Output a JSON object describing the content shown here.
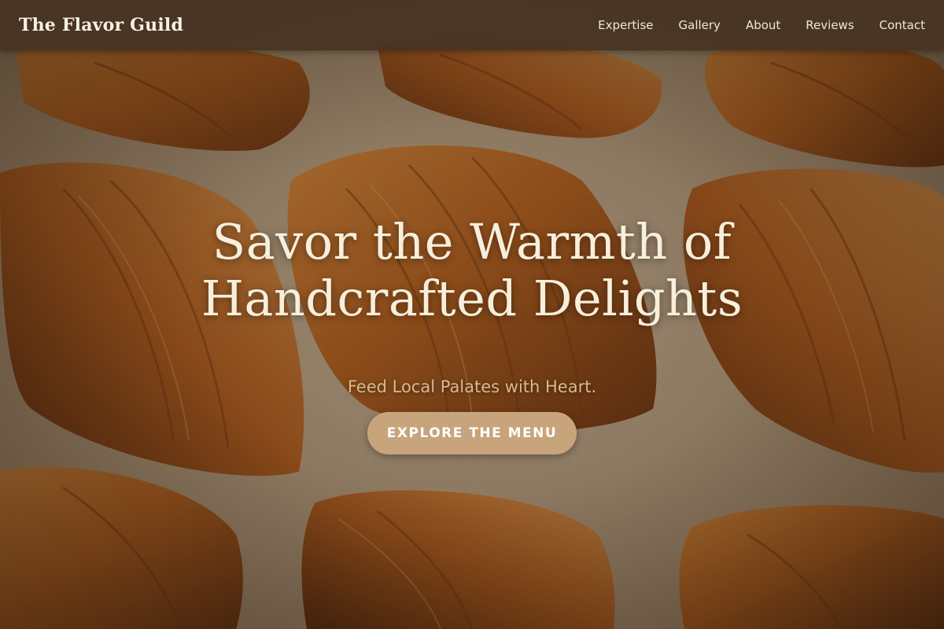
{
  "navbar": {
    "brand": "The Flavor Guild",
    "links": [
      {
        "label": "Expertise"
      },
      {
        "label": "Gallery"
      },
      {
        "label": "About"
      },
      {
        "label": "Reviews"
      },
      {
        "label": "Contact"
      }
    ]
  },
  "hero": {
    "title_line_1": "Savor the Warmth of",
    "title_line_2": "Handcrafted Delights",
    "subtitle": "Feed Local Palates with Heart.",
    "cta_label": "EXPLORE THE MENU",
    "background_image": "croissants-on-parchment-photo"
  },
  "colors": {
    "navbar_bg": "#48342a",
    "brand_text": "#f6f0e6",
    "title_text": "#f7efdc",
    "subtitle_text": "#d9b98f",
    "cta_bg": "#c8a47c",
    "cta_text": "#ffffff"
  }
}
